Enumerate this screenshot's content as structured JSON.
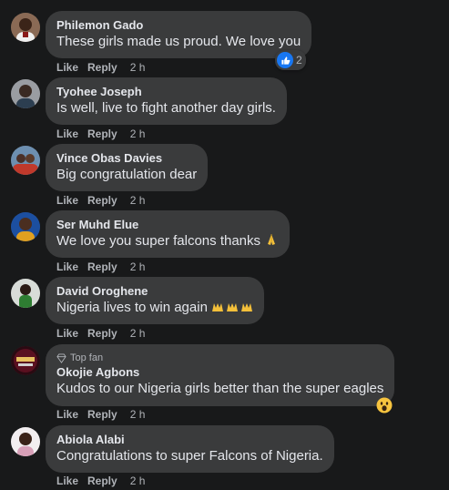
{
  "actions": {
    "like_label": "Like",
    "reply_label": "Reply"
  },
  "colors": {
    "background": "#18191a",
    "bubble": "#3a3b3c",
    "text": "#e4e6eb",
    "secondary_text": "#b0b3b8",
    "like_blue": "#1877f2"
  },
  "comments": [
    {
      "author": "Philemon Gado",
      "text": "These girls made us proud. We love you",
      "time": "2 h",
      "reaction_icon": "like-icon",
      "reaction_count": "2"
    },
    {
      "author": "Tyohee Joseph",
      "text": "Is well, live to fight another day girls.",
      "time": "2 h"
    },
    {
      "author": "Vince Obas Davies",
      "text": "Big congratulation dear",
      "time": "2 h"
    },
    {
      "author": "Ser Muhd Elue",
      "text": "We love you super falcons thanks",
      "emoji": "praying-hands-icon",
      "time": "2 h"
    },
    {
      "author": "David Oroghene",
      "text": "Nigeria lives to win again",
      "emoji": "raised-hands-icon x3",
      "time": "2 h"
    },
    {
      "badge": "Top fan",
      "badge_icon": "diamond-icon",
      "author": "Okojie Agbons",
      "text": "Kudos to our Nigeria girls better than the super eagles",
      "time": "2 h",
      "reaction_icon": "wow-emoji-icon"
    },
    {
      "author": "Abiola Alabi",
      "text": "Congratulations to super Falcons of Nigeria.",
      "time": "2 h"
    }
  ]
}
